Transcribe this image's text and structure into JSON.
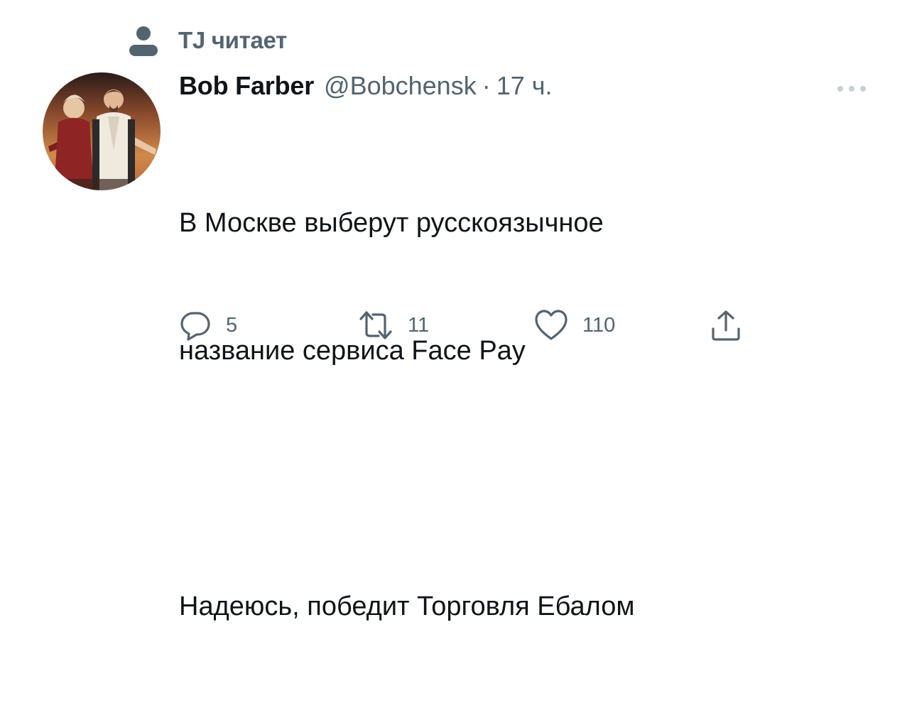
{
  "context": {
    "icon": "person-icon",
    "text": "TJ читает"
  },
  "tweet": {
    "author_name": "Bob Farber",
    "author_handle": "@Bobchensk",
    "separator": "·",
    "timestamp": "17 ч.",
    "text_line_1": "В Москве выберут русскоязычное",
    "text_line_2": "название сервиса Face Pay",
    "text_line_3": "Надеюсь, победит Торговля Ебалом"
  },
  "actions": {
    "reply_count": "5",
    "retweet_count": "11",
    "like_count": "110"
  },
  "colors": {
    "text_primary": "#0f1419",
    "text_secondary": "#536471"
  }
}
